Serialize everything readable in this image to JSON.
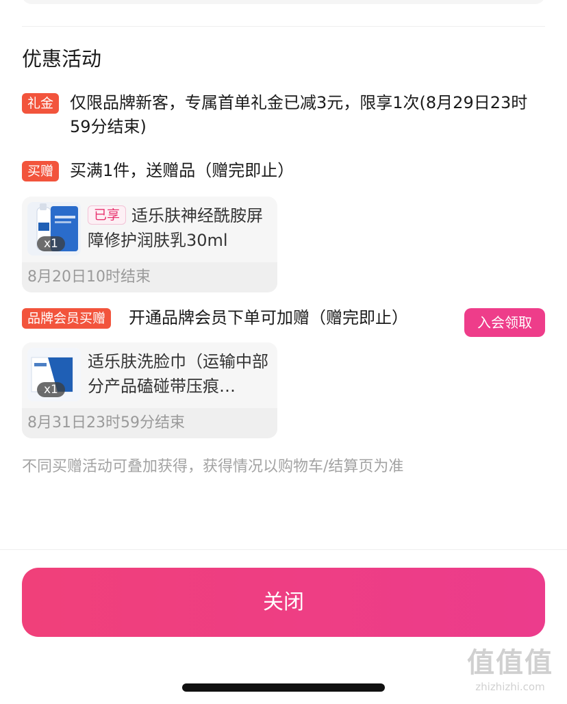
{
  "section_title": "优惠活动",
  "promotions": [
    {
      "tag": "礼金",
      "text": "仅限品牌新客，专属首单礼金已减3元，限享1次(8月29日23时59分结束)"
    },
    {
      "tag": "买赠",
      "text": "买满1件，送赠品（赠完即止）",
      "gift": {
        "badge": "已享",
        "name": "适乐肤神经酰胺屏障修护润肤乳30ml",
        "qty": "x1",
        "end_time": "8月20日10时结束"
      }
    },
    {
      "tag": "品牌会员买赠",
      "text": "开通品牌会员下单可加赠（赠完即止）",
      "action_label": "入会领取",
      "gift": {
        "name": "适乐肤洗脸巾（运输中部分产品磕碰带压痕…",
        "qty": "x1",
        "end_time": "8月31日23时59分结束"
      }
    }
  ],
  "note": "不同买赠活动可叠加获得，获得情况以购物车/结算页为准",
  "close_label": "关闭",
  "watermark": {
    "big": "值值值",
    "small": "zhizhizhi.com"
  },
  "colors": {
    "tag_red": "#f2543c",
    "accent_pink": "#ee3d8a"
  }
}
